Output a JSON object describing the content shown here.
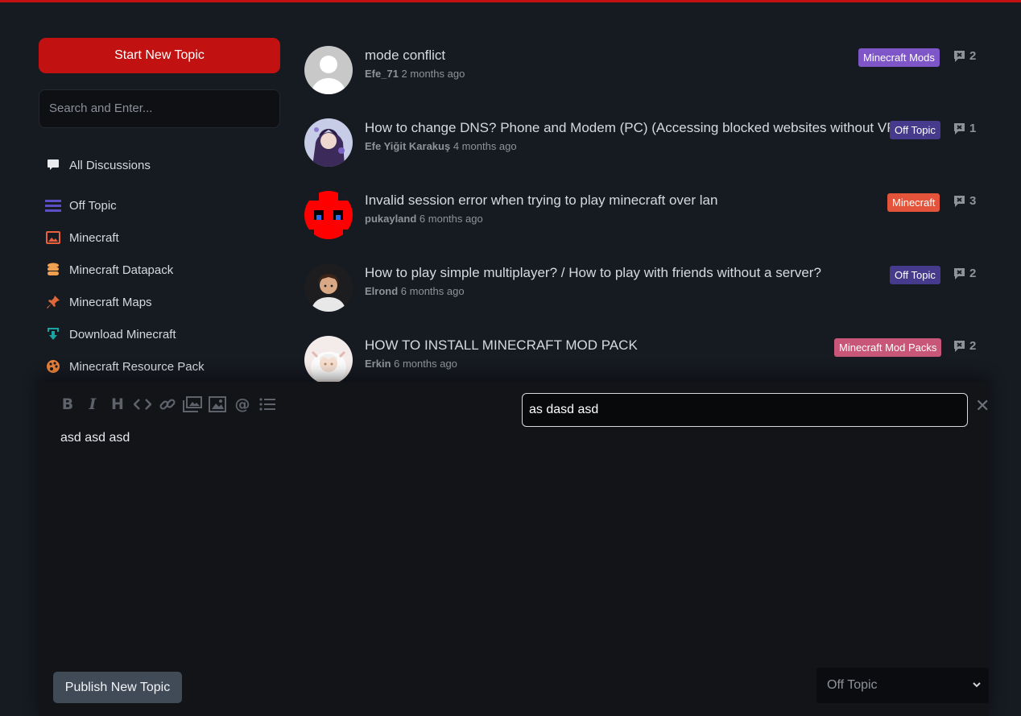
{
  "sidebar": {
    "new_topic_label": "Start New Topic",
    "search_placeholder": "Search and Enter...",
    "all_discussions": "All Discussions",
    "categories": [
      {
        "label": "Off Topic",
        "icon": "bars-icon",
        "color": "#5a4fc4"
      },
      {
        "label": "Minecraft",
        "icon": "image-icon",
        "color": "#e8603c"
      },
      {
        "label": "Minecraft Datapack",
        "icon": "database-icon",
        "color": "#f0a050"
      },
      {
        "label": "Minecraft Maps",
        "icon": "pin-icon",
        "color": "#e06838"
      },
      {
        "label": "Download Minecraft",
        "icon": "download-icon",
        "color": "#1aa3a3"
      },
      {
        "label": "Minecraft Resource Pack",
        "icon": "palette-icon",
        "color": "#e8803a"
      }
    ]
  },
  "discussions": [
    {
      "title": "mode conflict",
      "author": "Efe_71",
      "time": "2 months ago",
      "tag": "Minecraft Mods",
      "tag_color": "#7e56c7",
      "replies": "2"
    },
    {
      "title": "How to change DNS? Phone and Modem (PC) (Accessing blocked websites without VPN",
      "author": "Efe Yiğit Karakuş",
      "time": "4 months ago",
      "tag": "Off Topic",
      "tag_color": "#453a8c",
      "replies": "1"
    },
    {
      "title": "Invalid session error when trying to play minecraft over lan",
      "author": "pukayland",
      "time": "6 months ago",
      "tag": "Minecraft",
      "tag_color": "#e3543a",
      "replies": "3"
    },
    {
      "title": "How to play simple multiplayer? / How to play with friends without a server?",
      "author": "Elrond",
      "time": "6 months ago",
      "tag": "Off Topic",
      "tag_color": "#453a8c",
      "replies": "2"
    },
    {
      "title": "HOW TO INSTALL MINECRAFT MOD PACK",
      "author": "Erkin",
      "time": "6 months ago",
      "tag": "Minecraft Mod Packs",
      "tag_color": "#c75678",
      "replies": "2"
    }
  ],
  "composer": {
    "title_value": "as dasd asd",
    "body_text": "asd asd asd",
    "publish_label": "Publish New Topic",
    "category_selected": "Off Topic"
  }
}
